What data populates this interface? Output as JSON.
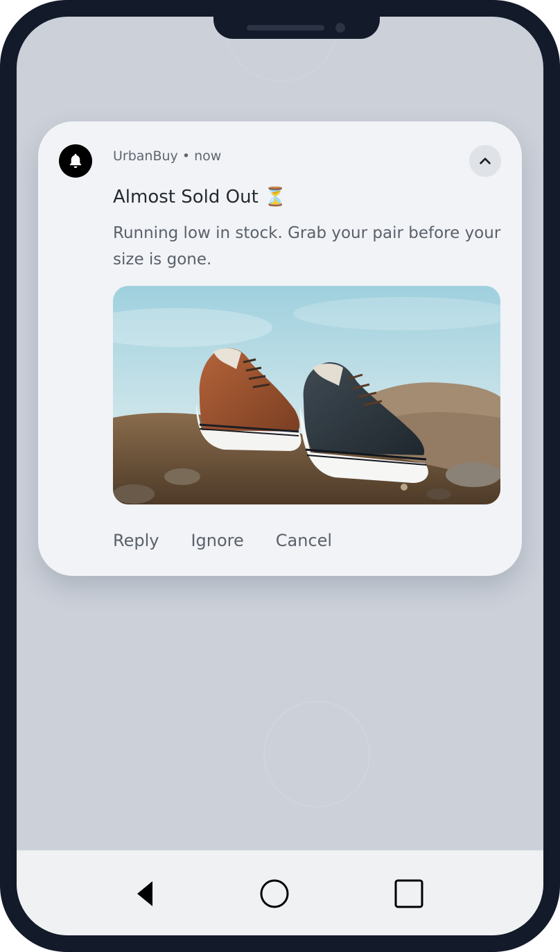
{
  "notification": {
    "app_name": "UrbanBuy",
    "time": "now",
    "separator": "•",
    "title": "Almost Sold Out ⏳",
    "body": "Running low in stock. Grab your pair before your size is gone.",
    "image_alt": "Two sneakers on a rocky hilltop"
  },
  "actions": {
    "reply": "Reply",
    "ignore": "Ignore",
    "cancel": "Cancel"
  },
  "icons": {
    "app": "bell-icon",
    "collapse": "chevron-up-icon",
    "back": "back-triangle-icon",
    "home": "home-circle-icon",
    "recents": "recents-square-icon"
  },
  "colors": {
    "frame": "#131a2a",
    "screen": "#cbd0d9",
    "card": "#f1f3f6",
    "text_secondary": "#5a616b"
  }
}
